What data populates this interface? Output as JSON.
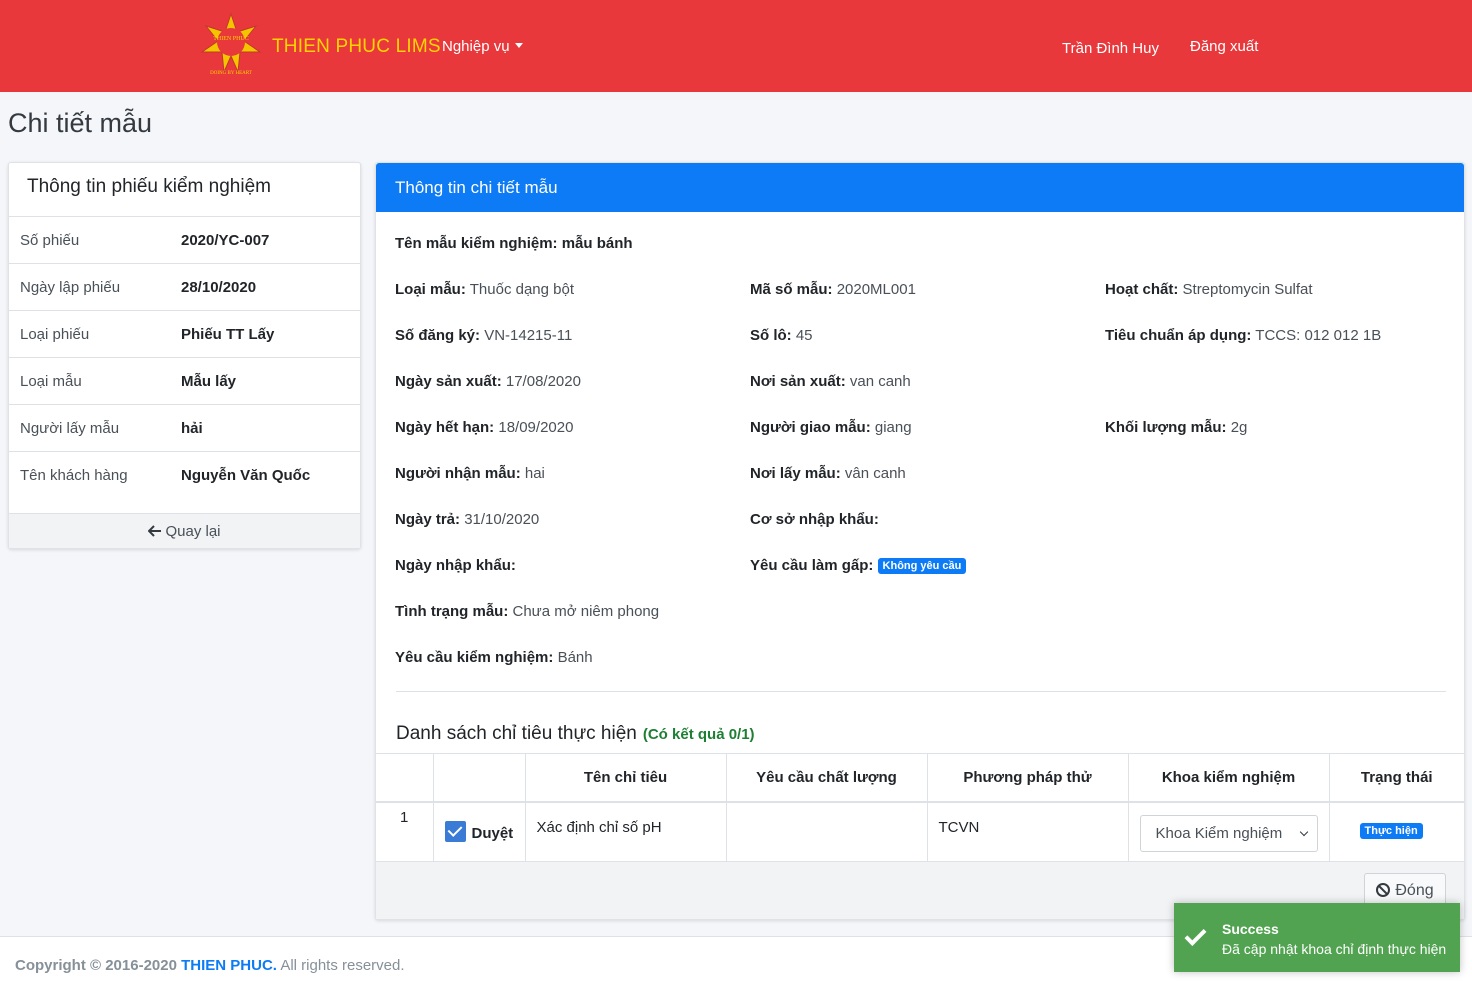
{
  "navbar": {
    "logo_text_top": "THIEN PHUC",
    "logo_text_bottom": "DOING BY HEART",
    "brand": "THIEN PHUC LIMS",
    "menu": "Nghiệp vụ",
    "user": "Trần Đình Huy",
    "logout": "Đăng xuất"
  },
  "page_title": "Chi tiết mẫu",
  "left_card": {
    "title": "Thông tin phiếu kiểm nghiệm",
    "rows": [
      {
        "label": "Số phiếu",
        "value": "2020/YC-007"
      },
      {
        "label": "Ngày lập phiếu",
        "value": "28/10/2020"
      },
      {
        "label": "Loại phiếu",
        "value": "Phiếu TT Lấy"
      },
      {
        "label": "Loại mẫu",
        "value": "Mẫu lấy"
      },
      {
        "label": "Người lấy mẫu",
        "value": "hải"
      },
      {
        "label": "Tên khách hàng",
        "value": "Nguyễn Văn Quốc"
      }
    ],
    "back": "Quay lại"
  },
  "right_card": {
    "title": "Thông tin chi tiết mẫu",
    "sample_name_label": "Tên mẫu kiểm nghiệm:",
    "sample_name": "mẫu bánh",
    "fields": {
      "loai_mau": {
        "label": "Loại mẫu:",
        "value": "Thuốc dạng bột"
      },
      "ma_so_mau": {
        "label": "Mã số mẫu:",
        "value": "2020ML001"
      },
      "hoat_chat": {
        "label": "Hoạt chất:",
        "value": "Streptomycin Sulfat"
      },
      "so_dang_ky": {
        "label": "Số đăng ký:",
        "value": "VN-14215-11"
      },
      "so_lo": {
        "label": "Số lô:",
        "value": "45"
      },
      "tieu_chuan": {
        "label": "Tiêu chuẩn áp dụng:",
        "value": "TCCS: 012 012 1B"
      },
      "ngay_san_xuat": {
        "label": "Ngày sản xuất:",
        "value": "17/08/2020"
      },
      "noi_san_xuat": {
        "label": "Nơi sản xuất:",
        "value": "van canh"
      },
      "ngay_het_han": {
        "label": "Ngày hết hạn:",
        "value": "18/09/2020"
      },
      "nguoi_giao_mau": {
        "label": "Người giao mẫu:",
        "value": "giang"
      },
      "khoi_luong": {
        "label": "Khối lượng mẫu:",
        "value": "2g"
      },
      "nguoi_nhan_mau": {
        "label": "Người nhận mẫu:",
        "value": "hai"
      },
      "noi_lay_mau": {
        "label": "Nơi lấy mẫu:",
        "value": "vân canh"
      },
      "ngay_tra": {
        "label": "Ngày trả:",
        "value": "31/10/2020"
      },
      "co_so_nhap_khau": {
        "label": "Cơ sở nhập khẩu:",
        "value": ""
      },
      "ngay_nhap_khau": {
        "label": "Ngày nhập khẩu:",
        "value": ""
      },
      "yeu_cau_gap": {
        "label": "Yêu cầu làm gấp:",
        "value": "Không yêu cầu"
      },
      "tinh_trang": {
        "label": "Tình trạng mẫu:",
        "value": "Chưa mở niêm phong"
      },
      "yeu_cau_kn": {
        "label": "Yêu cầu kiểm nghiệm:",
        "value": "Bánh"
      }
    },
    "list_title": "Danh sách chỉ tiêu thực hiện",
    "list_count": "(Có kết quả 0/1)",
    "table": {
      "headers": [
        "",
        "",
        "Tên chỉ tiêu",
        "Yêu cầu chất lượng",
        "Phương pháp thử",
        "Khoa kiểm nghiệm",
        "Trạng thái"
      ],
      "rows": [
        {
          "no": "1",
          "approve_label": "Duyệt",
          "approved": true,
          "name": "Xác định chỉ số pH",
          "requirement": "",
          "method": "TCVN",
          "department": "Khoa Kiểm nghiệm",
          "status": "Thực hiện"
        }
      ]
    },
    "close": "Đóng"
  },
  "footer": {
    "copyright": "Copyright © 2016-2020",
    "brand": "THIEN PHUC.",
    "rights": "All rights reserved."
  },
  "toast": {
    "title": "Success",
    "message": "Đã cập nhật khoa chỉ định thực hiện"
  },
  "colors": {
    "navbar": "#e8383b",
    "brand_text": "#ffd400",
    "primary": "#0d7bf5",
    "success_toast": "#51a351",
    "count_text": "#1e7e34"
  }
}
